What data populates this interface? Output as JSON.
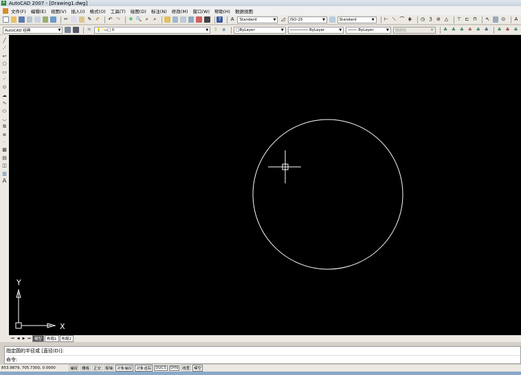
{
  "title": "AutoCAD 2007 - [Drawing1.dwg]",
  "menu": [
    "文件(F)",
    "编辑(E)",
    "视图(V)",
    "插入(I)",
    "格式(O)",
    "工具(T)",
    "绘图(D)",
    "标注(N)",
    "修改(M)",
    "窗口(W)",
    "帮助(H)",
    "数据视图"
  ],
  "toolbar": {
    "text_style": "Standard",
    "dim_style": "ISO-25",
    "table_style": "Standard",
    "workspace": "AutoCAD 经典",
    "layer": "0",
    "color": "ByLayer",
    "linetype": "ByLayer",
    "lineweight": "ByLayer",
    "plotstyle": "随颜色"
  },
  "draw_tools": [
    "line",
    "construction-line",
    "polyline",
    "polygon",
    "rectangle",
    "arc",
    "circle",
    "revision-cloud",
    "spline",
    "ellipse",
    "ellipse-arc",
    "insert-block",
    "make-block",
    "point",
    "hatch",
    "gradient",
    "region",
    "table",
    "multiline-text"
  ],
  "draw_tool_glyphs": [
    "╱",
    "⟋",
    "↩",
    "⬠",
    "▭",
    "◜",
    "⊙",
    "☁",
    "∿",
    "⬭",
    "◡",
    "⧉",
    "⧈",
    "·",
    "▦",
    "▤",
    "◫",
    "▥",
    "A"
  ],
  "canvas": {
    "background": "#000000",
    "entity_color": "#ffffff",
    "ucs": {
      "x_label": "X",
      "y_label": "Y"
    }
  },
  "layout_tabs": [
    {
      "label": "模型",
      "active": true
    },
    {
      "label": "布局1",
      "active": false
    },
    {
      "label": "布局2",
      "active": false
    }
  ],
  "command": {
    "history": "指定圆的半径或 [直径(D)]:",
    "prompt": "命令:"
  },
  "status": {
    "coords": "853.9879, 705.7300, 0.0000",
    "buttons": [
      {
        "label": "捕捉",
        "on": false
      },
      {
        "label": "栅格",
        "on": false
      },
      {
        "label": "正交",
        "on": false
      },
      {
        "label": "极轴",
        "on": false
      },
      {
        "label": "对象捕捉",
        "on": true
      },
      {
        "label": "对象追踪",
        "on": true
      },
      {
        "label": "DUCS",
        "on": true
      },
      {
        "label": "DYN",
        "on": true
      },
      {
        "label": "线宽",
        "on": false
      },
      {
        "label": "模型",
        "on": true
      }
    ]
  }
}
